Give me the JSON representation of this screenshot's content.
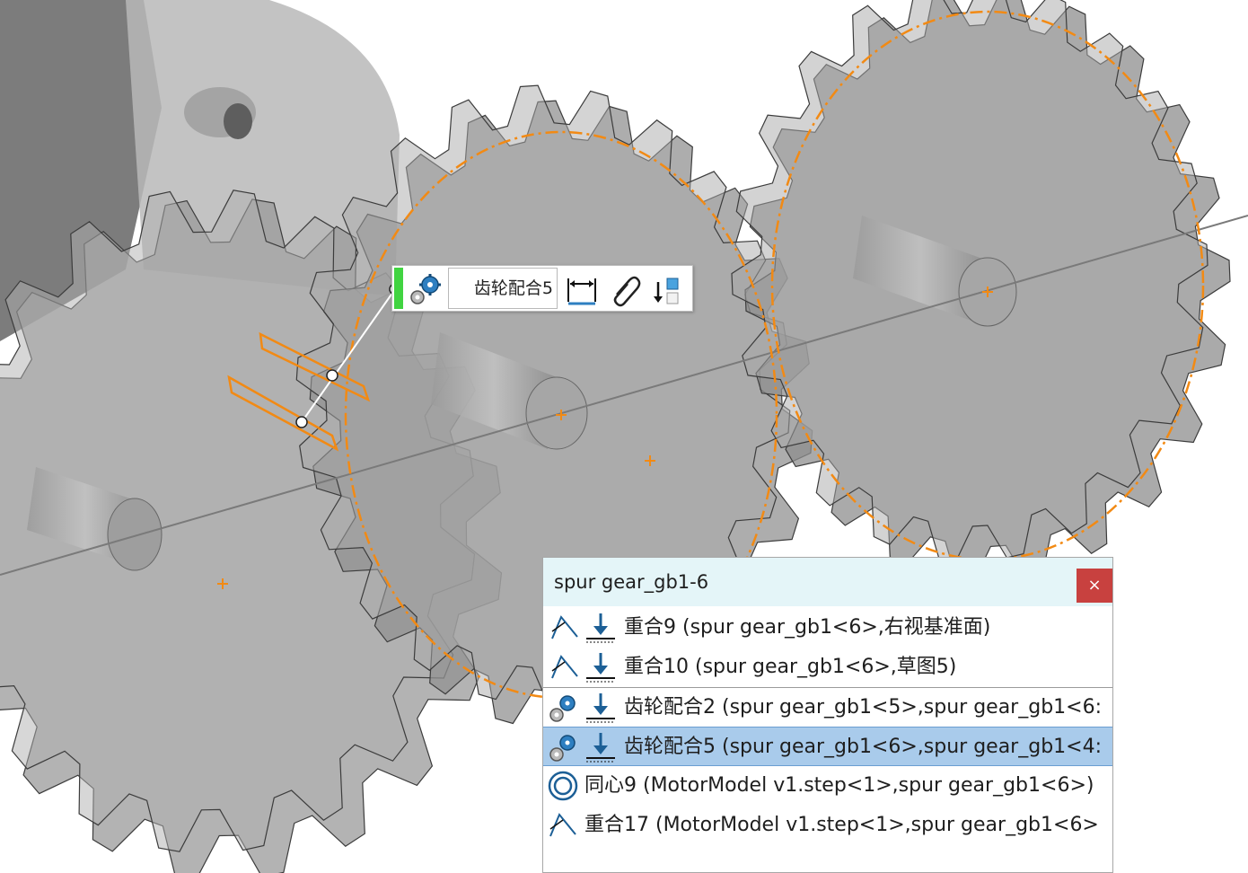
{
  "callout": {
    "mate_name": "齿轮配合5",
    "icons": [
      "gear-mate-icon",
      "dimension-icon",
      "paperclip-icon",
      "push-to-back-icon"
    ],
    "flag_color": "#41d441"
  },
  "popup": {
    "title": "spur gear_gb1-6",
    "close_label": "×",
    "close_color": "#c8413f",
    "header_color": "#e4f5f8",
    "selected_color": "#a9cbeb",
    "rows": [
      {
        "label": "重合9 (spur gear_gb1<6>,右视基准面)",
        "icons": [
          "coincident-icon",
          "mate-arrow-icon"
        ],
        "state": "normal"
      },
      {
        "label": "重合10 (spur gear_gb1<6>,草图5)",
        "icons": [
          "coincident-icon",
          "mate-arrow-icon"
        ],
        "state": "normal"
      },
      {
        "label": "齿轮配合2 (spur gear_gb1<5>,spur gear_gb1<6:",
        "icons": [
          "gear-mate-icon",
          "mate-arrow-icon"
        ],
        "state": "boxed"
      },
      {
        "label": "齿轮配合5 (spur gear_gb1<6>,spur gear_gb1<4:",
        "icons": [
          "gear-mate-icon",
          "mate-arrow-icon"
        ],
        "state": "selected"
      },
      {
        "label": "同心9 (MotorModel v1.step<1>,spur gear_gb1<6>)",
        "icons": [
          "concentric-icon"
        ],
        "state": "normal"
      },
      {
        "label": "重合17 (MotorModel v1.step<1>,spur gear_gb1<6>",
        "icons": [
          "coincident-icon"
        ],
        "state": "normal"
      }
    ]
  },
  "colors": {
    "highlight_orange": "#f28a14",
    "gear_gray": "#8f8f8f"
  }
}
